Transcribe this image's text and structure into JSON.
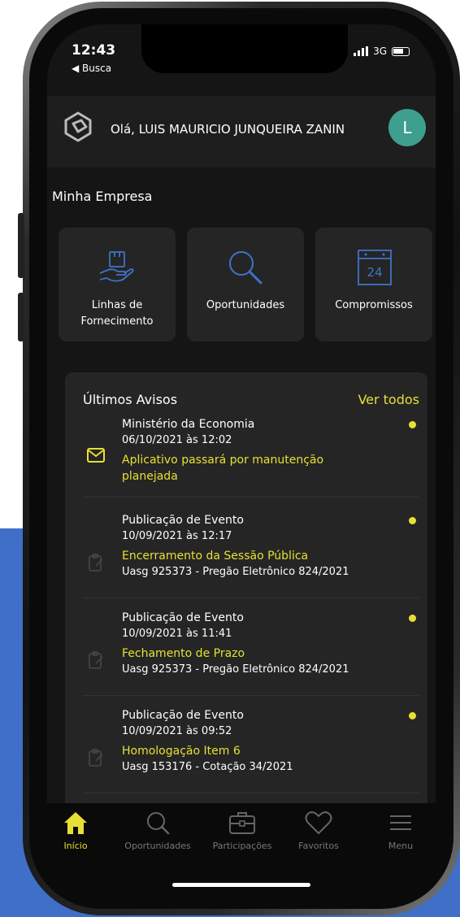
{
  "status": {
    "time": "12:43",
    "back_label": "◀ Busca",
    "network": "3G"
  },
  "header": {
    "greeting": "Olá, LUIS MAURICIO JUNQUEIRA ZANIN",
    "avatar_initial": "L"
  },
  "section": {
    "title": "Minha Empresa"
  },
  "cards": [
    {
      "label": "Linhas de Fornecimento",
      "icon": "hand-box-icon"
    },
    {
      "label": "Oportunidades",
      "icon": "search-icon"
    },
    {
      "label": "Compromissos",
      "icon": "calendar-icon",
      "calendar_day": "24"
    }
  ],
  "avisos": {
    "title": "Últimos Avisos",
    "see_all": "Ver todos",
    "items": [
      {
        "sender": "Ministério da Economia",
        "date": "06/10/2021 às 12:02",
        "subject": "Aplicativo passará por manutenção planejada",
        "detail": "",
        "icon": "envelope-icon"
      },
      {
        "sender": "Publicação de Evento",
        "date": "10/09/2021 às 12:17",
        "subject": "Encerramento da Sessão Pública",
        "detail": "Uasg 925373 - Pregão Eletrônico 824/2021",
        "icon": "clipboard-icon"
      },
      {
        "sender": "Publicação de Evento",
        "date": "10/09/2021 às 11:41",
        "subject": "Fechamento de Prazo",
        "detail": "Uasg 925373 - Pregão Eletrônico 824/2021",
        "icon": "clipboard-icon"
      },
      {
        "sender": "Publicação de Evento",
        "date": "10/09/2021 às 09:52",
        "subject": "Homologação Item 6",
        "detail": "Uasg 153176 - Cotação 34/2021",
        "icon": "clipboard-icon"
      }
    ]
  },
  "tabbar": {
    "items": [
      {
        "label": "Início",
        "icon": "home-icon",
        "active": true
      },
      {
        "label": "Oportunidades",
        "icon": "search-icon",
        "active": false
      },
      {
        "label": "Participações",
        "icon": "briefcase-icon",
        "active": false
      },
      {
        "label": "Favoritos",
        "icon": "heart-icon",
        "active": false
      },
      {
        "label": "Menu",
        "icon": "menu-icon",
        "active": false
      }
    ]
  },
  "colors": {
    "accent": "#e6e034",
    "avatar": "#3f9f8e",
    "icon_blue": "#3f73c9",
    "background": "#151515",
    "card": "#252525",
    "backdrop_blue": "#3f6fc8"
  }
}
